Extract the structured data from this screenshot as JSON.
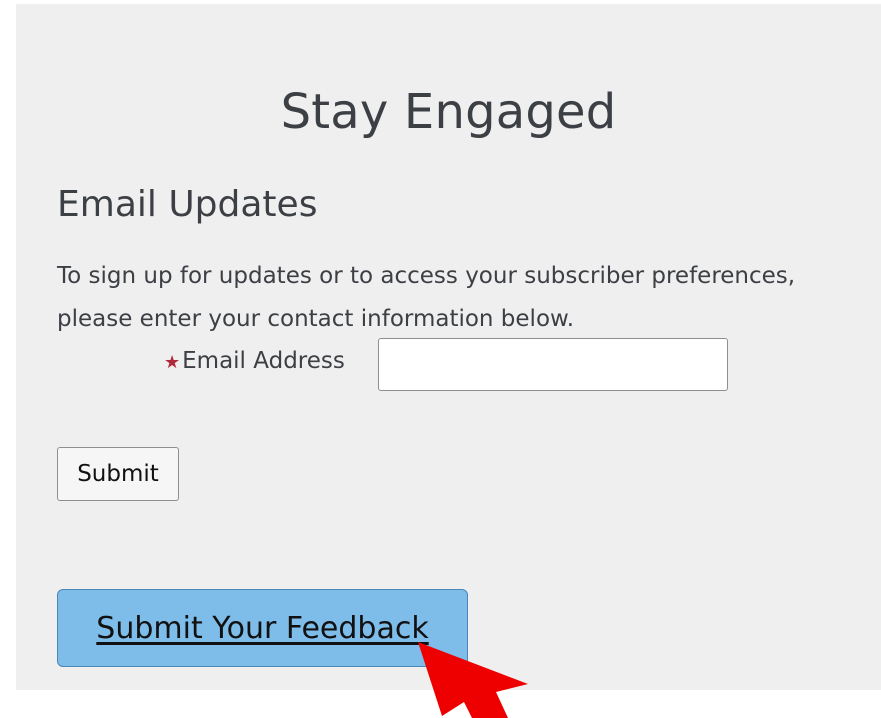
{
  "page": {
    "title": "Stay Engaged",
    "section_title": "Email Updates",
    "description": "To sign up for updates or to access your subscriber preferences, please enter your contact information below."
  },
  "form": {
    "required_marker": "★",
    "email_label": "Email Address",
    "email_value": "",
    "email_placeholder": "",
    "submit_label": "Submit"
  },
  "feedback": {
    "link_label": "Submit Your Feedback"
  },
  "colors": {
    "panel_background": "#efefef",
    "feedback_button": "#7ebcea",
    "required_star": "#b0283c",
    "pointer_arrow": "#ee0000"
  },
  "icons": {
    "pointer": "red-arrow-pointer-icon"
  }
}
